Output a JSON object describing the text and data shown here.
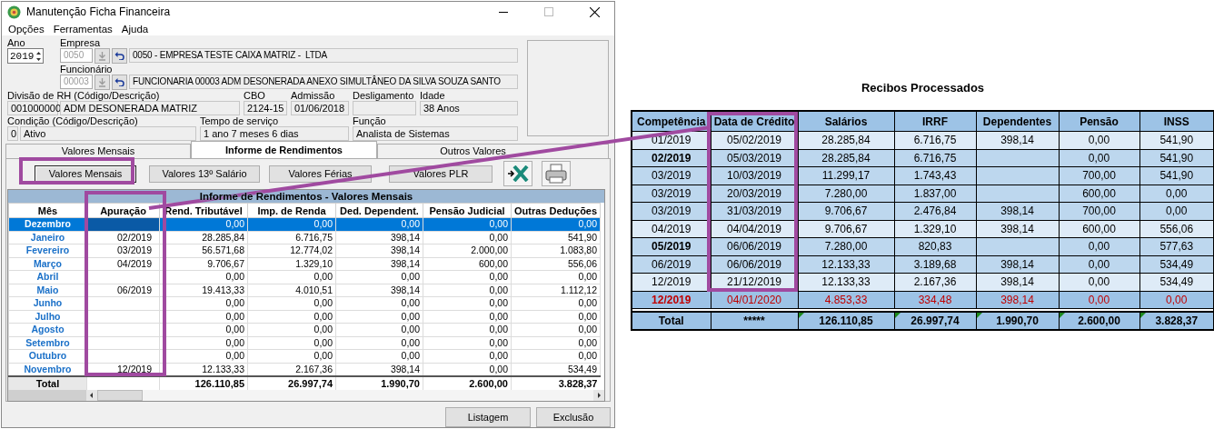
{
  "window": {
    "title": "Manutenção Ficha Financeira"
  },
  "menu": [
    {
      "label": "Opções"
    },
    {
      "label": "Ferramentas"
    },
    {
      "label": "Ajuda"
    }
  ],
  "form": {
    "ano": {
      "label": "Ano",
      "value": "2019"
    },
    "empresa": {
      "label": "Empresa",
      "code": "0050",
      "disabled": true,
      "name": "0050 - EMPRESA TESTE CAIXA MATRIZ -  LTDA"
    },
    "funcionario": {
      "label": "Funcionário",
      "code": "00003",
      "disabled": true,
      "name": "FUNCIONARIA 00003 ADM DESONERADA ANEXO SIMULTÂNEO DA SILVA SOUZA SANTO"
    },
    "divisao": {
      "label": "Divisão de RH (Código/Descrição)",
      "code": "001000000",
      "name": "ADM DESONERADA MATRIZ"
    },
    "cbo": {
      "label": "CBO",
      "value": "2124-15"
    },
    "admissao": {
      "label": "Admissão",
      "value": "01/06/2018"
    },
    "desligamento": {
      "label": "Desligamento"
    },
    "idade": {
      "label": "Idade",
      "value": "38 Anos"
    },
    "condicao": {
      "label": "Condição (Código/Descrição)",
      "code": "0",
      "name": "Ativo"
    },
    "tempo": {
      "label": "Tempo de serviço",
      "value": "1 ano 7 meses 6 dias"
    },
    "funcao": {
      "label": "Função",
      "value": "Analista de Sistemas"
    }
  },
  "tabs": [
    {
      "label": "Valores Mensais",
      "selected": false
    },
    {
      "label": "Informe de Rendimentos",
      "selected": true
    },
    {
      "label": "Outros Valores",
      "selected": false
    }
  ],
  "actions": [
    {
      "label": "Valores Mensais",
      "selected": true
    },
    {
      "label": "Valores 13º Salário",
      "selected": false
    },
    {
      "label": "Valores Férias",
      "selected": false
    },
    {
      "label": "Valores PLR",
      "selected": false
    }
  ],
  "grid": {
    "title": "Informe de Rendimentos - Valores Mensais",
    "columns": [
      "Mês",
      "Apuração",
      "Rend. Tributável",
      "Imp. de Renda",
      "Ded. Dependent.",
      "Pensão Judicial",
      "Outras Deduções"
    ],
    "rows": [
      {
        "month": "Dezembro",
        "selected": true,
        "values": [
          "0,00",
          "0,00",
          "0,00",
          "0,00",
          "0,00"
        ]
      },
      {
        "month": "Janeiro",
        "apuracao": "02/2019",
        "selected": false,
        "values": [
          "28.285,84",
          "6.716,75",
          "398,14",
          "0,00",
          "541,90"
        ]
      },
      {
        "month": "Fevereiro",
        "apuracao": "03/2019",
        "selected": false,
        "values": [
          "56.571,68",
          "12.774,02",
          "398,14",
          "2.000,00",
          "1.083,80"
        ]
      },
      {
        "month": "Março",
        "apuracao": "04/2019",
        "selected": false,
        "values": [
          "9.706,67",
          "1.329,10",
          "398,14",
          "600,00",
          "556,06"
        ]
      },
      {
        "month": "Abril",
        "selected": false,
        "values": [
          "0,00",
          "0,00",
          "0,00",
          "0,00",
          "0,00"
        ]
      },
      {
        "month": "Maio",
        "apuracao": "06/2019",
        "selected": false,
        "values": [
          "19.413,33",
          "4.010,51",
          "398,14",
          "0,00",
          "1.112,12"
        ]
      },
      {
        "month": "Junho",
        "selected": false,
        "values": [
          "0,00",
          "0,00",
          "0,00",
          "0,00",
          "0,00"
        ]
      },
      {
        "month": "Julho",
        "selected": false,
        "values": [
          "0,00",
          "0,00",
          "0,00",
          "0,00",
          "0,00"
        ]
      },
      {
        "month": "Agosto",
        "selected": false,
        "values": [
          "0,00",
          "0,00",
          "0,00",
          "0,00",
          "0,00"
        ]
      },
      {
        "month": "Setembro",
        "selected": false,
        "values": [
          "0,00",
          "0,00",
          "0,00",
          "0,00",
          "0,00"
        ]
      },
      {
        "month": "Outubro",
        "selected": false,
        "values": [
          "0,00",
          "0,00",
          "0,00",
          "0,00",
          "0,00"
        ]
      },
      {
        "month": "Novembro",
        "apuracao": "12/2019",
        "selected": false,
        "values": [
          "12.133,33",
          "2.167,36",
          "398,14",
          "0,00",
          "534,49"
        ]
      }
    ],
    "total": {
      "label": "Total",
      "values": [
        "126.110,85",
        "26.997,74",
        "1.990,70",
        "2.600,00",
        "3.828,37"
      ]
    }
  },
  "footer_buttons": [
    {
      "label": "Listagem"
    },
    {
      "label": "Exclusão"
    }
  ],
  "recibos": {
    "title": "Recibos Processados",
    "columns": [
      "Competência",
      "Data de Crédito",
      "Salários",
      "IRRF",
      "Dependentes",
      "Pensão",
      "INSS"
    ],
    "rows": [
      {
        "color": "#deebf7",
        "bold": false,
        "alert": false,
        "cells": [
          "01/2019",
          "05/02/2019",
          "28.285,84",
          "6.716,75",
          "398,14",
          "0,00",
          "541,90"
        ]
      },
      {
        "color": "#bdd7ee",
        "bold": true,
        "alert": false,
        "cells": [
          "02/2019",
          "05/03/2019",
          "28.285,84",
          "6.716,75",
          "",
          "0,00",
          "541,90"
        ]
      },
      {
        "color": "#bdd7ee",
        "bold": false,
        "alert": false,
        "cells": [
          "03/2019",
          "10/03/2019",
          "11.299,17",
          "1.743,43",
          "",
          "700,00",
          "541,90"
        ]
      },
      {
        "color": "#bdd7ee",
        "bold": false,
        "alert": false,
        "cells": [
          "03/2019",
          "20/03/2019",
          "7.280,00",
          "1.837,00",
          "",
          "600,00",
          "0,00"
        ]
      },
      {
        "color": "#bdd7ee",
        "bold": false,
        "alert": false,
        "cells": [
          "03/2019",
          "31/03/2019",
          "9.706,67",
          "2.476,84",
          "398,14",
          "700,00",
          "0,00"
        ]
      },
      {
        "color": "#deebf7",
        "bold": false,
        "alert": false,
        "cells": [
          "04/2019",
          "04/04/2019",
          "9.706,67",
          "1.329,10",
          "398,14",
          "600,00",
          "556,06"
        ]
      },
      {
        "color": "#bdd7ee",
        "bold": true,
        "alert": false,
        "cells": [
          "05/2019",
          "06/06/2019",
          "7.280,00",
          "820,83",
          "",
          "0,00",
          "577,63"
        ]
      },
      {
        "color": "#bdd7ee",
        "bold": false,
        "alert": false,
        "cells": [
          "06/2019",
          "06/06/2019",
          "12.133,33",
          "3.189,68",
          "398,14",
          "0,00",
          "534,49"
        ]
      },
      {
        "color": "#deebf7",
        "bold": false,
        "alert": false,
        "cells": [
          "12/2019",
          "21/12/2019",
          "12.133,33",
          "2.167,36",
          "398,14",
          "0,00",
          "534,49"
        ]
      },
      {
        "color": "#9dc3e6",
        "bold": true,
        "alert": true,
        "cells": [
          "12/2019",
          "04/01/2020",
          "4.853,33",
          "334,48",
          "398,14",
          "0,00",
          "0,00"
        ]
      }
    ],
    "total": [
      {
        "text": "Total",
        "flagged": false
      },
      {
        "text": "*****",
        "flagged": false
      },
      {
        "text": "126.110,85",
        "flagged": true
      },
      {
        "text": "26.997,74",
        "flagged": true
      },
      {
        "text": "1.990,70",
        "flagged": true
      },
      {
        "text": "2.600,00",
        "flagged": true
      },
      {
        "text": "3.828,37",
        "flagged": true
      }
    ]
  }
}
